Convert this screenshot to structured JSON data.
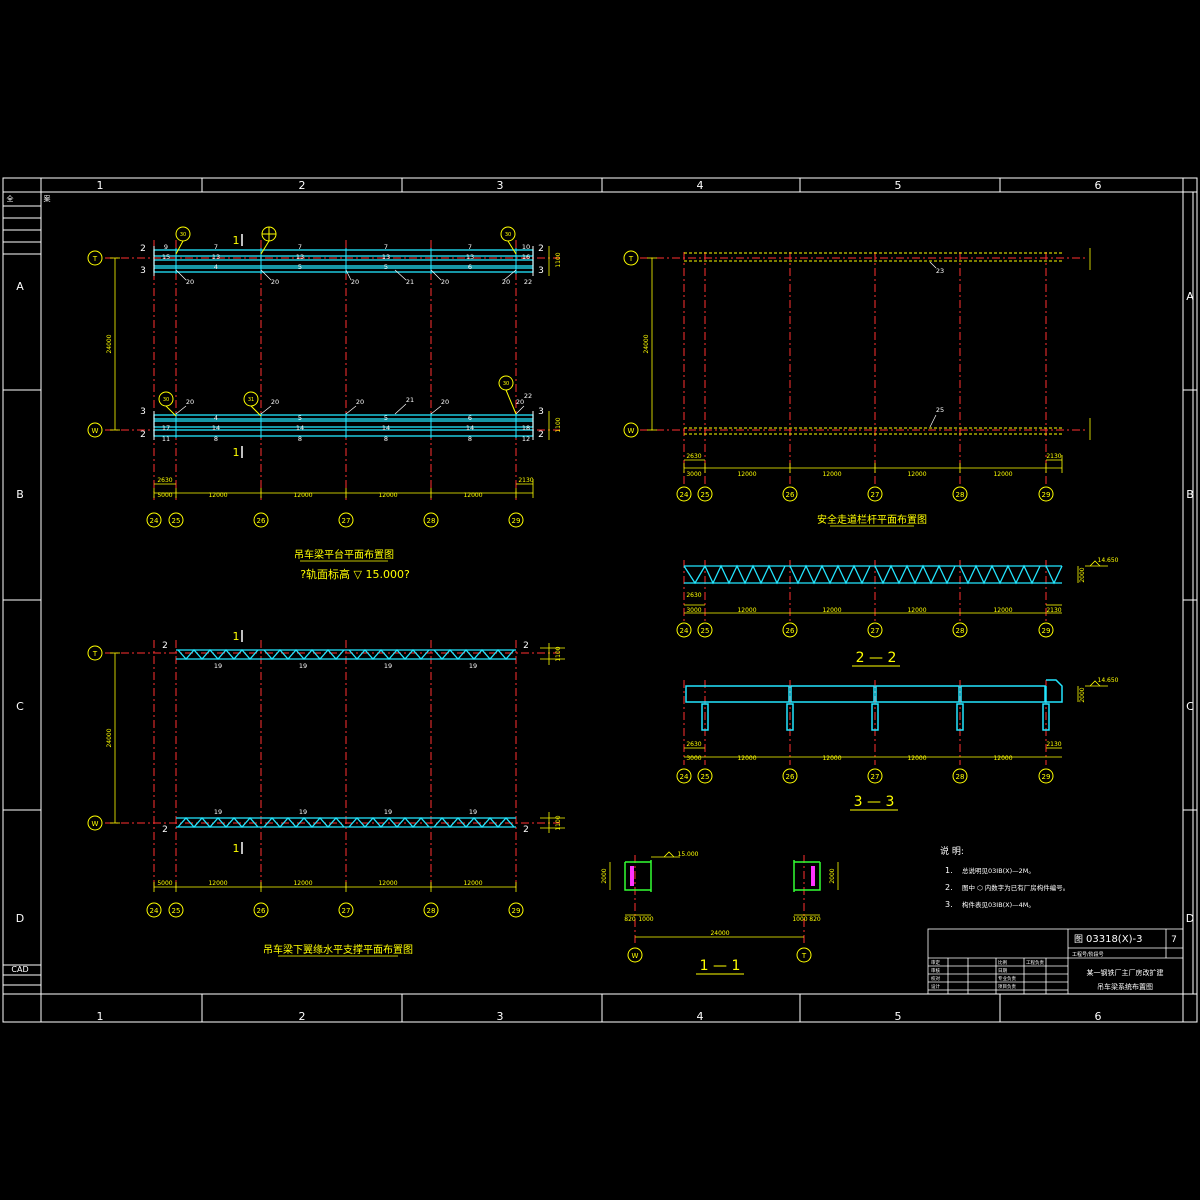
{
  "colors": {
    "background": "#000000",
    "frame": "#ffffff",
    "grid_red": "#ff3030",
    "beam_cyan": "#22e6ff",
    "dim_yellow": "#ffff00",
    "green": "#33ff33",
    "magenta": "#ff33ff",
    "white_text": "#ffffff"
  },
  "border": {
    "columns": [
      "1",
      "2",
      "3",
      "4",
      "5",
      "6"
    ],
    "rows": [
      "A",
      "B",
      "C",
      "D"
    ],
    "corner_marks": [
      "全",
      "案"
    ],
    "cad_label": "CAD"
  },
  "plan1": {
    "axis_rows": [
      "T",
      "W"
    ],
    "axis_cols": [
      "24",
      "25",
      "26",
      "27",
      "28",
      "29"
    ],
    "top_labels": [
      "9",
      "7",
      "7",
      "7",
      "7",
      "10"
    ],
    "top_row2": [
      "15",
      "13",
      "13",
      "13",
      "13",
      "16"
    ],
    "bot_row1": [
      "17",
      "14",
      "14",
      "14",
      "14",
      "18"
    ],
    "bot_row2": [
      "11",
      "8",
      "8",
      "8",
      "8",
      "12"
    ],
    "top_mid": [
      "4",
      "5",
      "5",
      "6"
    ],
    "pt20": "20",
    "pt21": "21",
    "pt22": "22",
    "section_marks": [
      "2",
      "3",
      "1"
    ],
    "dims": [
      "5000",
      "12000",
      "12000",
      "12000",
      "12000",
      "2130",
      "2630",
      "24000",
      "1100",
      "800"
    ],
    "title": "吊车梁平台平面布置图",
    "subtitle": "?轨面标高 ▽ 15.000?"
  },
  "plan2": {
    "axis_rows": [
      "T",
      "W"
    ],
    "axis_cols": [
      "24",
      "25",
      "26",
      "27",
      "28",
      "29"
    ],
    "labels": [
      "23",
      "25"
    ],
    "dims": [
      "3000",
      "12000",
      "12000",
      "12000",
      "12000",
      "2130",
      "2630",
      "24000"
    ],
    "title": "安全走道栏杆平面布置图"
  },
  "plan3": {
    "axis_rows": [
      "T",
      "W"
    ],
    "axis_cols": [
      "24",
      "25",
      "26",
      "27",
      "28",
      "29"
    ],
    "truss_label": "19",
    "dims": [
      "5000",
      "12000",
      "12000",
      "12000",
      "12000",
      "24000",
      "1100"
    ],
    "title": "吊车梁下翼缘水平支撑平面布置图"
  },
  "section22": {
    "axis_cols": [
      "24",
      "25",
      "26",
      "27",
      "28",
      "29"
    ],
    "elev": "14.650",
    "height": "2000",
    "dims": [
      "3000",
      "12000",
      "12000",
      "12000",
      "12000",
      "2130",
      "2630"
    ],
    "title": "2 — 2"
  },
  "section33": {
    "axis_cols": [
      "24",
      "25",
      "26",
      "27",
      "28",
      "29"
    ],
    "elev": "14.650",
    "height": "2000",
    "dims": [
      "3000",
      "12000",
      "12000",
      "12000",
      "12000",
      "2130",
      "2630"
    ],
    "title": "3 — 3"
  },
  "section11": {
    "elev": "15.000",
    "left_axis": "W",
    "right_axis": "T",
    "span": "24000",
    "height": "2000",
    "left_dims": [
      "820",
      "1000"
    ],
    "right_dims": [
      "1000",
      "820"
    ],
    "title": "1 — 1"
  },
  "notes": {
    "heading": "说 明:",
    "items": [
      {
        "num": "1.",
        "text": "总说明见03IB(X)—2M。"
      },
      {
        "num": "2.",
        "text": "图中 ⬡ 内数字为已有厂房构件编号。"
      },
      {
        "num": "3.",
        "text": "构件表见03IB(X)—4M。"
      }
    ]
  },
  "title_block": {
    "drawing_no": "03318(X)-3",
    "drawing_no_prefix": "图",
    "sheet": "7",
    "project": "某一钢铁厂主厂房改扩建",
    "drawing_name": "吊车梁系统布置图",
    "stage": "工程号/阶段号",
    "cells": [
      "审定",
      "审核",
      "校对",
      "设计",
      "比例",
      "日期",
      "专业负责",
      "项目负责",
      "工程负责"
    ]
  }
}
